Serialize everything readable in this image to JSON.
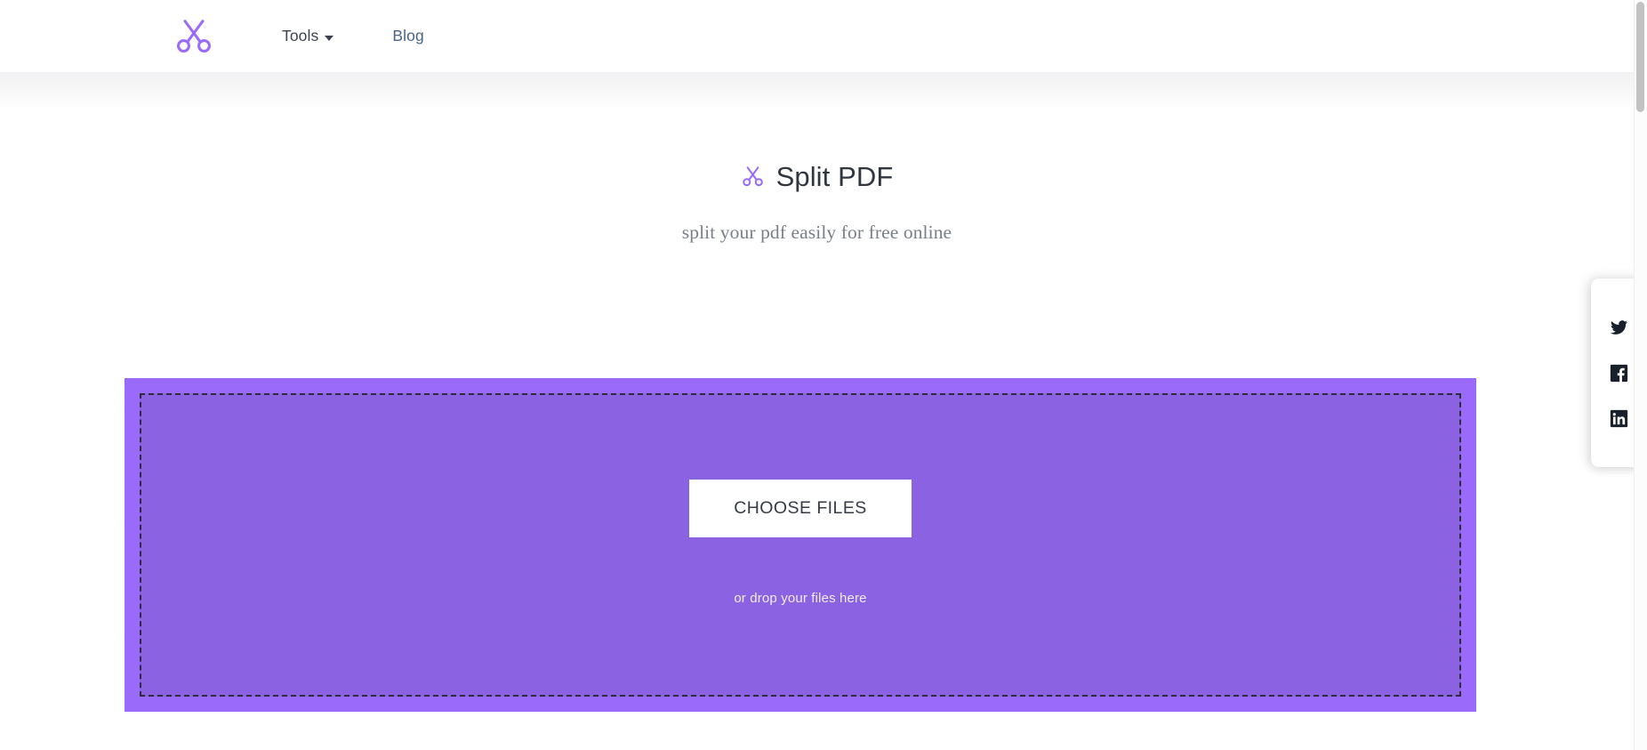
{
  "header": {
    "brand_icon": "scissors-icon",
    "brand_label": "",
    "nav": [
      {
        "label": "Tools",
        "icon": "chevron-down-icon",
        "has_dropdown": true
      },
      {
        "label": "Blog",
        "icon": "",
        "has_dropdown": false
      }
    ]
  },
  "hero": {
    "icon": "scissors-icon",
    "title": "Split PDF",
    "subtitle": "split your pdf easily for free online"
  },
  "dropzone": {
    "button_label": "CHOOSE FILES",
    "hint": "or drop your files here",
    "outer_color": "#9a6bfb",
    "inner_color": "#8a62e2",
    "border_style": "dashed",
    "border_color": "#2c2c3a"
  },
  "social": {
    "items": [
      {
        "name": "twitter-icon",
        "label": "Twitter"
      },
      {
        "name": "facebook-icon",
        "label": "Facebook"
      },
      {
        "name": "linkedin-icon",
        "label": "LinkedIn"
      }
    ]
  },
  "colors": {
    "brand_purple": "#9a6bfb",
    "nav_link": "#4a6585",
    "nav_text": "#3b4350",
    "heading": "#2f3640",
    "subtitle": "#797f88"
  }
}
